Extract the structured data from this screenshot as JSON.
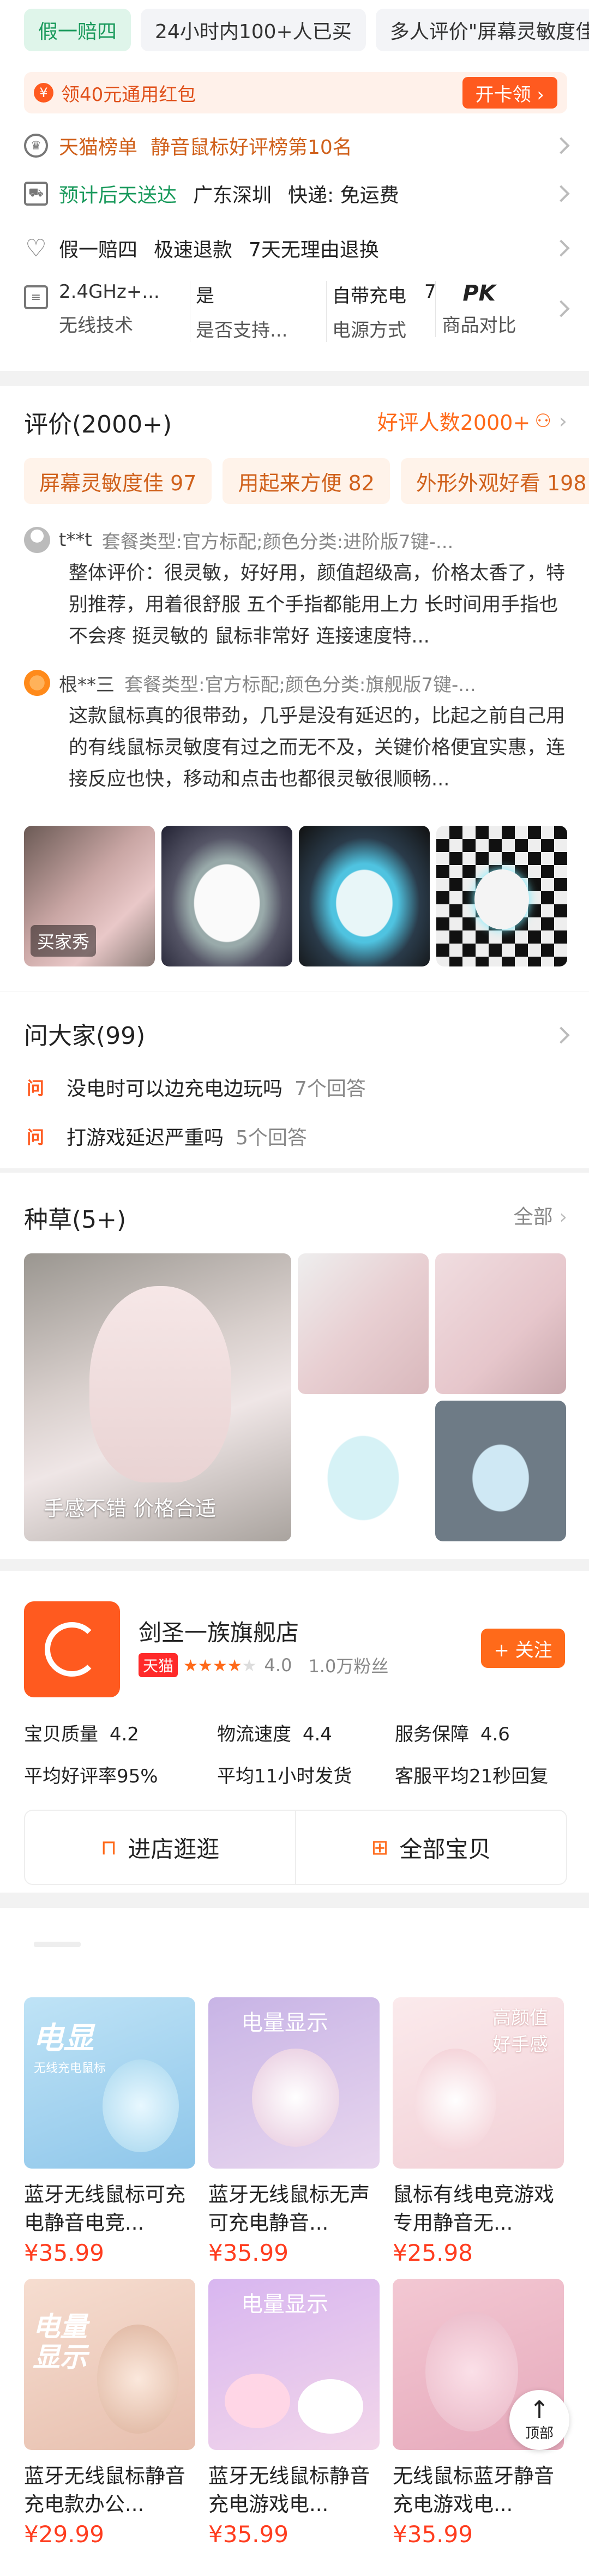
{
  "top_chips": [
    "假一赔四",
    "24小时内100+人已买",
    "多人评价\"屏幕灵敏度佳\""
  ],
  "coupon": {
    "icon": "red-packet-icon",
    "text": "领40元通用红包",
    "button": "开卡领 ›"
  },
  "ranking": {
    "label": "天猫榜单",
    "text": "静音鼠标好评榜第10名"
  },
  "shipping": {
    "eta": "预计后天送达",
    "origin": "广东深圳",
    "express": "快递: 免运费"
  },
  "guarantees": [
    "假一赔四",
    "极速退款",
    "7天无理由退换"
  ],
  "specs": [
    {
      "value": "2.4GHz+...",
      "label": "无线技术"
    },
    {
      "value": "是",
      "label": "是否支持..."
    },
    {
      "value": "自带充电",
      "label": "电源方式"
    },
    {
      "value": "7",
      "label": ""
    }
  ],
  "compare": {
    "badge": "PK",
    "label": "商品对比"
  },
  "reviews": {
    "title": "评价(2000+)",
    "good_count": "好评人数2000+",
    "tags": [
      "屏幕灵敏度佳 97",
      "用起来方便 82",
      "外形外观好看 198"
    ],
    "items": [
      {
        "user": "t**t",
        "variant": "套餐类型:官方标配;颜色分类:进阶版7键-...",
        "text": "整体评价：很灵敏，好好用，颜值超级高，价格太香了，特别推荐，用着很舒服 五个手指都能用上力 长时间用手指也不会疼 挺灵敏的 鼠标非常好 连接速度特..."
      },
      {
        "user": "根**三",
        "variant": "套餐类型:官方标配;颜色分类:旗舰版7键-...",
        "text": "这款鼠标真的很带劲，几乎是没有延迟的，比起之前自己用的有线鼠标灵敏度有过之而无不及，关键价格便宜实惠，连接反应也快，移动和点击也都很灵敏很顺畅..."
      }
    ],
    "buyer_show_label": "买家秀"
  },
  "qa": {
    "title": "问大家(99)",
    "badge": "问",
    "items": [
      {
        "q": "没电时可以边充电边玩吗",
        "count": "7个回答"
      },
      {
        "q": "打游戏延迟严重吗",
        "count": "5个回答"
      }
    ]
  },
  "seeding": {
    "title": "种草(5+)",
    "all": "全部",
    "caption": "手感不错 价格合适"
  },
  "shop": {
    "name": "剑圣一族旗舰店",
    "platform": "天猫",
    "rating": "4.0",
    "fans": "1.0万粉丝",
    "follow": "+ 关注",
    "metrics": [
      {
        "label": "宝贝质量",
        "score": "4.2",
        "sub": "平均好评率95%"
      },
      {
        "label": "物流速度",
        "score": "4.4",
        "sub": "平均11小时发货"
      },
      {
        "label": "服务保障",
        "score": "4.6",
        "sub": "客服平均21秒回复"
      }
    ],
    "enter": "进店逛逛",
    "all_items": "全部宝贝"
  },
  "products": [
    {
      "title": "蓝牙无线鼠标可充电静音电竞...",
      "price": "¥35.99",
      "img_text": "电显",
      "img_sub": "无线充电鼠标"
    },
    {
      "title": "蓝牙无线鼠标无声可充电静音...",
      "price": "¥35.99",
      "img_text": "电量显示",
      "img_sub": ""
    },
    {
      "title": "鼠标有线电竞游戏专用静音无...",
      "price": "¥25.98",
      "img_text": "高颜值 好手感",
      "img_sub": ""
    },
    {
      "title": "蓝牙无线鼠标静音充电款办公...",
      "price": "¥29.99",
      "img_text": "电量显示",
      "img_sub": ""
    },
    {
      "title": "蓝牙无线鼠标静音充电游戏电...",
      "price": "¥35.99",
      "img_text": "电量显示",
      "img_sub": ""
    },
    {
      "title": "无线鼠标蓝牙静音充电游戏电...",
      "price": "¥35.99",
      "img_text": "",
      "img_sub": ""
    }
  ],
  "back_top": "顶部",
  "colors": {
    "accent": "#ff6a1a",
    "price": "#ff3d1f",
    "green": "#1a9a5c",
    "tag_bg": "#fff3ea"
  }
}
